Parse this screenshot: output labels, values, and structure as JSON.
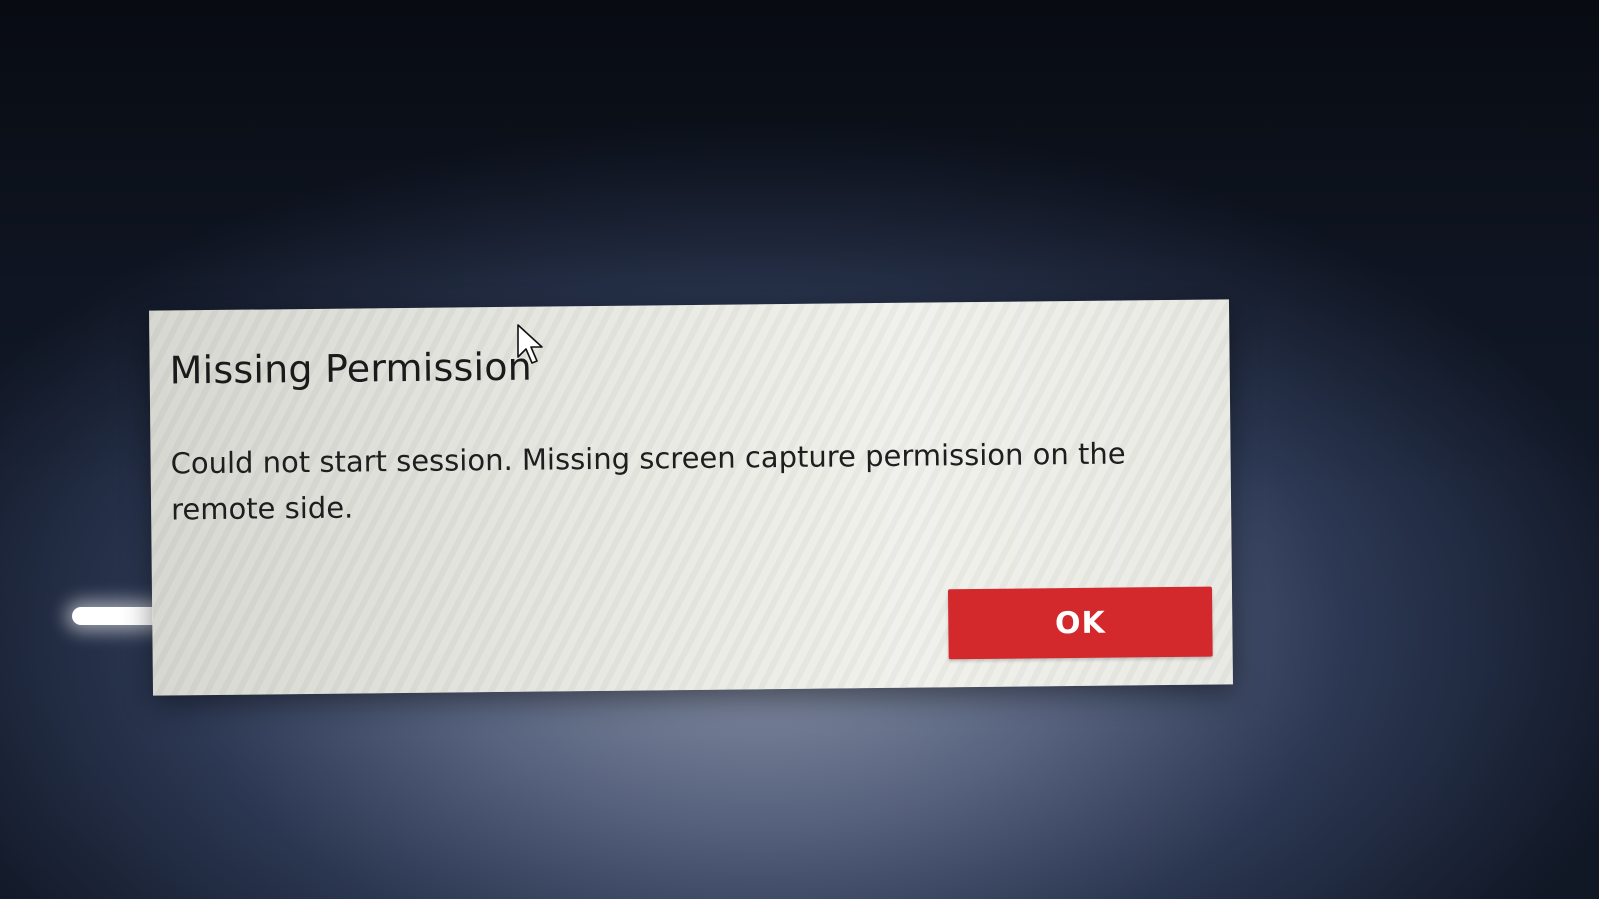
{
  "dialog": {
    "title": "Missing Permission",
    "message": "Could not start session. Missing screen capture permission on the remote side.",
    "ok_label": "OK"
  },
  "colors": {
    "ok_button": "#d3282c",
    "dialog_background": "#ececE6",
    "desktop_background": "#3a4663"
  },
  "icons": {
    "cursor": "mouse-pointer-icon"
  }
}
